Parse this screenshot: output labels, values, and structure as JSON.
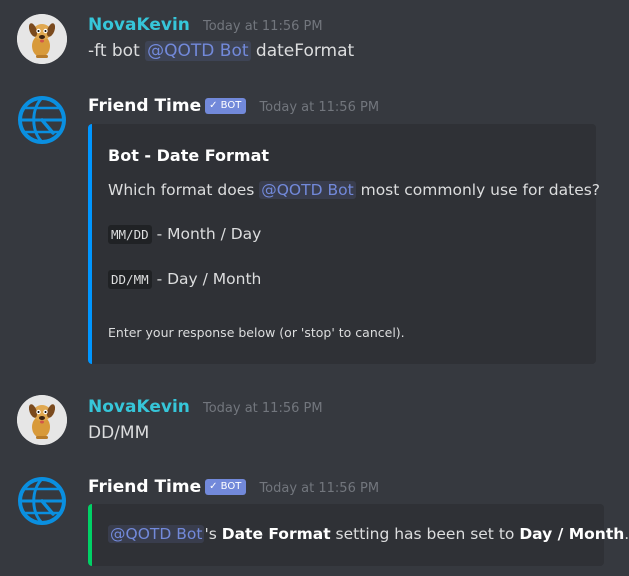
{
  "messages": [
    {
      "author": "NovaKevin",
      "timestamp": "Today at 11:56 PM",
      "avatar_icon": "dog-avatar-icon",
      "parts": [
        "-ft bot ",
        "@QOTD Bot",
        " dateFormat"
      ]
    },
    {
      "author": "Friend Time",
      "badge": "✓ BOT",
      "timestamp": "Today at 11:56 PM",
      "avatar_icon": "globe-avatar-icon",
      "embed": {
        "accent_color": "#0096ff",
        "title": "Bot - Date Format",
        "question": [
          "Which format does ",
          "@QOTD Bot",
          " most commonly use for dates?"
        ],
        "options": [
          {
            "code": "MM/DD",
            "text": " - Month / Day"
          },
          {
            "code": "DD/MM",
            "text": " - Day / Month"
          }
        ],
        "footer": "Enter your response below (or 'stop' to cancel)."
      }
    },
    {
      "author": "NovaKevin",
      "timestamp": "Today at 11:56 PM",
      "avatar_icon": "dog-avatar-icon",
      "text": "DD/MM"
    },
    {
      "author": "Friend Time",
      "badge": "✓ BOT",
      "timestamp": "Today at 11:56 PM",
      "avatar_icon": "globe-avatar-icon",
      "embed": {
        "accent_color": "#00d166",
        "parts": [
          "@QOTD Bot",
          "'s ",
          "Date Format",
          " setting has been set to ",
          "Day / Month",
          "."
        ]
      }
    }
  ],
  "colors": {
    "background": "#36393f",
    "embed_background": "#2f3136",
    "mention": "#7289da",
    "username_nova": "#36c6d9"
  }
}
